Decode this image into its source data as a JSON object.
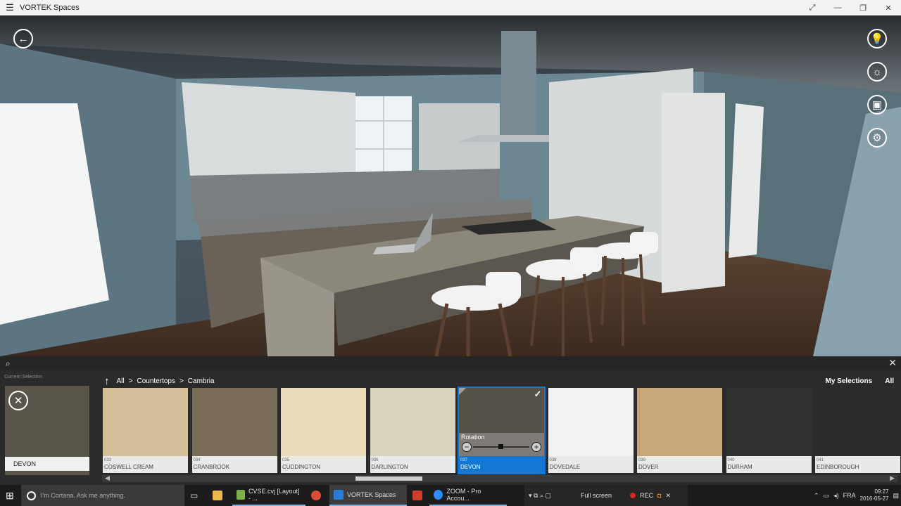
{
  "window": {
    "title": "VORTEK Spaces",
    "menu_icon": "hamburger-icon",
    "controls": [
      "fullscreen-icon",
      "minimize-icon",
      "restore-icon",
      "close-icon"
    ]
  },
  "scene": {
    "left_buttons": [
      "back-arrow-icon"
    ],
    "right_buttons": [
      "lightbulb-icon",
      "sun-icon",
      "image-icon",
      "gear-icon"
    ]
  },
  "search": {
    "placeholder": "",
    "close_glyph": "✕"
  },
  "current_selection": {
    "label": "Current Selection",
    "name": "DEVON"
  },
  "breadcrumb": {
    "items": [
      "All",
      "Countertops",
      "Cambria"
    ],
    "separator": ">"
  },
  "selection_links": {
    "my_selections": "My Selections",
    "all": "All"
  },
  "materials": [
    {
      "code": "033",
      "name": "COSWELL CREAM",
      "color": "#d5c09c",
      "selected": false
    },
    {
      "code": "034",
      "name": "CRANBROOK",
      "color": "#786c58",
      "selected": false
    },
    {
      "code": "035",
      "name": "CUDDINGTON",
      "color": "#e9dcb6",
      "selected": false
    },
    {
      "code": "036",
      "name": "DARLINGTON",
      "color": "#dad3bf",
      "selected": false
    },
    {
      "code": "037",
      "name": "DEVON",
      "color": "#56524a",
      "selected": true
    },
    {
      "code": "038",
      "name": "DOVEDALE",
      "color": "#f2f2f0",
      "selected": false
    },
    {
      "code": "039",
      "name": "DOVER",
      "color": "#c9a777",
      "selected": false
    },
    {
      "code": "040",
      "name": "DURHAM",
      "color": "#333232",
      "selected": false
    },
    {
      "code": "041",
      "name": "EDINBOROUGH",
      "color": "#2c2c2c",
      "selected": false
    }
  ],
  "rotation": {
    "label": "Rotation",
    "minus": "−",
    "plus": "+"
  },
  "taskbar": {
    "cortana_placeholder": "I'm Cortana. Ask me anything.",
    "apps": [
      {
        "name": "task-view",
        "label": "",
        "icon": "task-view-icon"
      },
      {
        "name": "file-explorer",
        "label": "",
        "icon": "folder-icon"
      },
      {
        "name": "cvse",
        "label": "CVSE.cvj [Layout] - ...",
        "icon": "cv-icon"
      },
      {
        "name": "chrome",
        "label": "",
        "icon": "chrome-icon"
      },
      {
        "name": "vortek",
        "label": "VORTEK Spaces",
        "icon": "vortek-icon"
      },
      {
        "name": "app-red",
        "label": "",
        "icon": "red-app-icon"
      },
      {
        "name": "zoom",
        "label": "ZOOM - Pro Accou...",
        "icon": "zoom-icon"
      }
    ],
    "fullscreen_label": "Full screen",
    "rec_label": "REC",
    "language": "FRA",
    "time": "09:27",
    "date": "2016-05-27"
  }
}
